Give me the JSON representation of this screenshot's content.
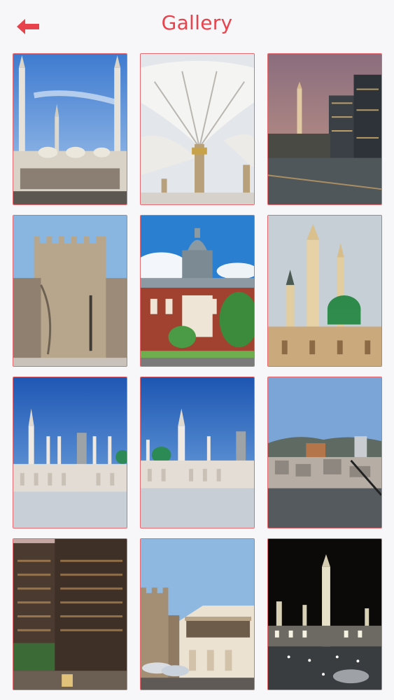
{
  "header": {
    "title": "Gallery",
    "back_icon": "arrow-left-icon",
    "accent_color": "#e8434c"
  },
  "gallery": {
    "items": [
      {
        "name": "gallery-photo-1",
        "scene": "mosque-minarets-day"
      },
      {
        "name": "gallery-photo-2",
        "scene": "umbrella-canopies"
      },
      {
        "name": "gallery-photo-3",
        "scene": "city-dusk-towers"
      },
      {
        "name": "gallery-photo-4",
        "scene": "fortress-ruins"
      },
      {
        "name": "gallery-photo-5",
        "scene": "brick-courthouse"
      },
      {
        "name": "gallery-photo-6",
        "scene": "green-dome-mosque"
      },
      {
        "name": "gallery-photo-7",
        "scene": "mosque-plaza-blue-sky"
      },
      {
        "name": "gallery-photo-8",
        "scene": "mosque-plaza-green-dome"
      },
      {
        "name": "gallery-photo-9",
        "scene": "city-skyline-hills"
      },
      {
        "name": "gallery-photo-10",
        "scene": "hotel-tower"
      },
      {
        "name": "gallery-photo-11",
        "scene": "fortress-rooftop-cafe"
      },
      {
        "name": "gallery-photo-12",
        "scene": "mosque-night-lights"
      }
    ]
  }
}
